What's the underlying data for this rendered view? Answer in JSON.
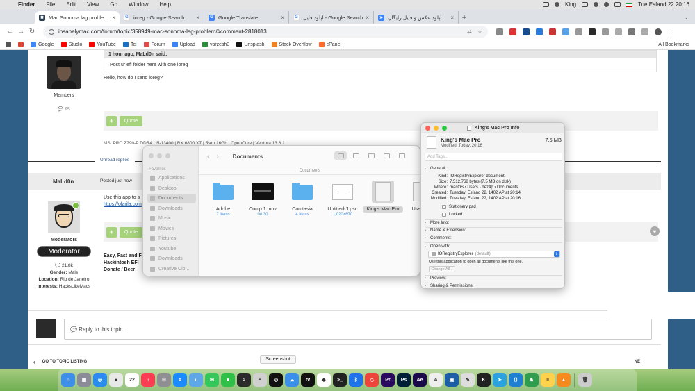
{
  "menubar": {
    "apple": "",
    "items": [
      "Finder",
      "File",
      "Edit",
      "View",
      "Go",
      "Window",
      "Help"
    ],
    "user": "King",
    "datetime": "Tue Esfand 22  20:16"
  },
  "tabs": [
    {
      "title": "Mac Sonoma lag problem - No",
      "fav_color": "#2c3e50",
      "fav_text": "✖"
    },
    {
      "title": "ioreg - Google Search",
      "fav_color": "#ffffff",
      "fav_text": "G"
    },
    {
      "title": "Google Translate",
      "fav_color": "#4285f4",
      "fav_text": "G"
    },
    {
      "title": "آپلود فایل - Google Search",
      "fav_color": "#ffffff",
      "fav_text": "G"
    },
    {
      "title": "آپلود عکس و فایل رایگان",
      "fav_color": "#3b82f6",
      "fav_text": "➤"
    }
  ],
  "tab_close": "×",
  "new_tab": "+",
  "address": {
    "url": "insanelymac.com/forum/topic/358949-mac-sonoma-lag-problem/#comment-2818013"
  },
  "bookmarks": [
    {
      "label": "",
      "color": "#555"
    },
    {
      "label": "",
      "color": "#db4437"
    },
    {
      "label": "Google",
      "color": "#4285f4"
    },
    {
      "label": "Studio",
      "color": "#ff0000"
    },
    {
      "label": "YouTube",
      "color": "#ff0000"
    },
    {
      "label": "Tci",
      "color": "#1b6fc2"
    },
    {
      "label": "Forum",
      "color": "#e04b4b"
    },
    {
      "label": "Upload",
      "color": "#3b82f6"
    },
    {
      "label": "varzesh3",
      "color": "#2b8c3b"
    },
    {
      "label": "Unsplash",
      "color": "#111"
    },
    {
      "label": "Stack Overflow",
      "color": "#f48024"
    },
    {
      "label": "cPanel",
      "color": "#ff6c2c"
    }
  ],
  "all_bookmarks": "All Bookmarks",
  "post1": {
    "role": "Members",
    "rep": "95",
    "quote_header": "1 hour ago, MaLd0n said:",
    "quote_body": "Post ur efi folder here with one ioreg",
    "reply": "Hello, how do I send ioreg?",
    "plus": "+",
    "quote_btn": "Quote",
    "signature": "MSI PRO Z790-P DDR4 | i5-13400 | RX 6800 XT | Ram 16Gb | OpenCore | Ventura 13.6.1"
  },
  "unread": "Unread replies",
  "post2": {
    "name": "MaLd0n",
    "posted": "Posted just now",
    "line1": "Use this app to s",
    "link": "https://olarila.com",
    "role": "Moderators",
    "badge": "Moderator",
    "rep": "21.8k",
    "gender_k": "Gender:",
    "gender_v": "Male",
    "location_k": "Location:",
    "location_v": "Rio de Janeiro",
    "interests_k": "Interests:",
    "interests_v": "HacksLikeMacs",
    "sig1": "Easy, Fast and F",
    "sig2": "Hackintosh EFI",
    "sig3": "Donate / Beer",
    "plus": "+",
    "quote_btn": "Quote"
  },
  "reply_placeholder": "💬 Reply to this topic...",
  "topic_nav": {
    "back": "‹",
    "label": "GO TO TOPIC LISTING",
    "next": "NE"
  },
  "tooltip": "Screenshot",
  "finder": {
    "title": "Documents",
    "path": "Documents",
    "sidebar_head": "Favorites",
    "sidebar": [
      "Applications",
      "Desktop",
      "Documents",
      "Downloads",
      "Music",
      "Movies",
      "Pictures",
      "Youtube",
      "Downloads",
      "Creative Clo..."
    ],
    "files": [
      {
        "name": "Adobe",
        "sub": "7 items",
        "kind": "folder"
      },
      {
        "name": "Comp 1.mov",
        "sub": "00:30",
        "kind": "movie"
      },
      {
        "name": "Camtasia",
        "sub": "4 items",
        "kind": "folder"
      },
      {
        "name": "Untitled-1.psd",
        "sub": "1,020×670",
        "kind": "psd"
      },
      {
        "name": "King's Mac Pro",
        "sub": "",
        "kind": "doc"
      },
      {
        "name": "User an",
        "sub": "",
        "kind": "doc"
      }
    ]
  },
  "info": {
    "title": "King's Mac Pro Info",
    "name": "King's Mac Pro",
    "modified": "Modified: Today, 20:16",
    "size": "7.5 MB",
    "tags_placeholder": "Add Tags...",
    "general": "General:",
    "kind_k": "Kind:",
    "kind_v": "IORegistryExplorer document",
    "size_k": "Size:",
    "size_v": "7,512,768 bytes (7.5 MB on disk)",
    "where_k": "Where:",
    "where_v": "macOS › Users › dez4p › Documents",
    "created_k": "Created:",
    "created_v": "Tuesday, Esfand 22, 1402 AP at 20:14",
    "modified_k": "Modified:",
    "modified_v": "Tuesday, Esfand 22, 1402 AP at 20:16",
    "stationery": "Stationery pad",
    "locked": "Locked",
    "more_info": "More Info:",
    "name_ext": "Name & Extension:",
    "comments": "Comments:",
    "open_with": "Open with:",
    "app": "IORegistryExplorer",
    "app_default": "(default)",
    "ow_note": "Use this application to open all documents like this one.",
    "change_all": "Change All...",
    "preview": "Preview:",
    "sharing": "Sharing & Permissions:"
  },
  "dock": [
    {
      "name": "finder",
      "color": "#3d8fe8",
      "txt": "☺"
    },
    {
      "name": "launchpad",
      "color": "#8b8b9a",
      "txt": "▦"
    },
    {
      "name": "safari",
      "color": "#2b8cf0",
      "txt": "◎"
    },
    {
      "name": "chrome",
      "color": "#e8e8e8",
      "txt": "●"
    },
    {
      "name": "calendar",
      "color": "#ffffff",
      "txt": "22"
    },
    {
      "name": "music",
      "color": "#fb3c52",
      "txt": "♪"
    },
    {
      "name": "settings",
      "color": "#8e8e93",
      "txt": "⚙"
    },
    {
      "name": "appstore",
      "color": "#1a8cff",
      "txt": "A"
    },
    {
      "name": "preview",
      "color": "#5ea8e8",
      "txt": "◐"
    },
    {
      "name": "messages",
      "color": "#34c759",
      "txt": "✉"
    },
    {
      "name": "facetime",
      "color": "#30c04a",
      "txt": "■"
    },
    {
      "name": "activity",
      "color": "#2a2a2a",
      "txt": "≈"
    },
    {
      "name": "screenshot",
      "color": "#d0d0d0",
      "txt": "⌗"
    },
    {
      "name": "clock",
      "color": "#111111",
      "txt": "◴"
    },
    {
      "name": "icloud",
      "color": "#3a90e8",
      "txt": "☁"
    },
    {
      "name": "tv",
      "color": "#111111",
      "txt": "tv"
    },
    {
      "name": "capcut",
      "color": "#ffffff",
      "txt": "◆"
    },
    {
      "name": "terminal",
      "color": "#222222",
      "txt": ">_"
    },
    {
      "name": "bluetooth",
      "color": "#1e73e8",
      "txt": "ᛒ"
    },
    {
      "name": "anydesk",
      "color": "#ef443b",
      "txt": "◇"
    },
    {
      "name": "premiere",
      "color": "#2a0a5e",
      "txt": "Pr"
    },
    {
      "name": "photoshop",
      "color": "#001e36",
      "txt": "Ps"
    },
    {
      "name": "aftereffects",
      "color": "#1a0a4a",
      "txt": "Ae"
    },
    {
      "name": "fontbook",
      "color": "#eeeeee",
      "txt": "A"
    },
    {
      "name": "virtualbox",
      "color": "#1d5fa6",
      "txt": "▣"
    },
    {
      "name": "notes2",
      "color": "#dddddd",
      "txt": "✎"
    },
    {
      "name": "k-app",
      "color": "#222222",
      "txt": "K"
    },
    {
      "name": "telegram",
      "color": "#2aa3df",
      "txt": "➤"
    },
    {
      "name": "vscode",
      "color": "#1f7fd0",
      "txt": "⟨⟩"
    },
    {
      "name": "monitor",
      "color": "#2e9e4e",
      "txt": "♞"
    },
    {
      "name": "notes",
      "color": "#ffd24d",
      "txt": "≡"
    },
    {
      "name": "vlc",
      "color": "#f58a1f",
      "txt": "▲"
    },
    {
      "name": "trash",
      "color": "#cccccc",
      "txt": "🗑"
    }
  ]
}
